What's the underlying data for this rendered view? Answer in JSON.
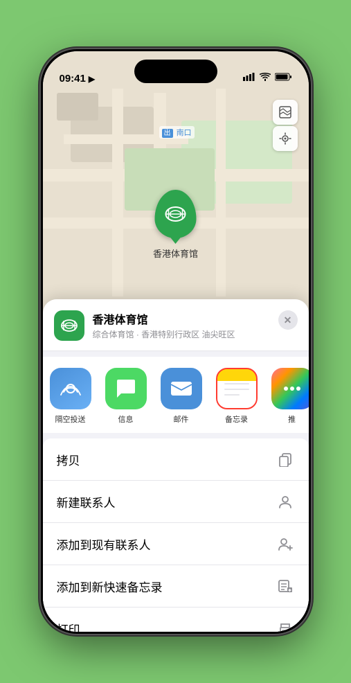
{
  "status_bar": {
    "time": "09:41",
    "location_arrow": "▶"
  },
  "map": {
    "label": "南口",
    "label_prefix": "出"
  },
  "venue": {
    "name": "香港体育馆",
    "subtitle": "综合体育馆 · 香港特别行政区 油尖旺区"
  },
  "share_items": [
    {
      "id": "airdrop",
      "label": "隔空投送",
      "class": "share-item-airdrop"
    },
    {
      "id": "message",
      "label": "信息",
      "class": "share-item-message"
    },
    {
      "id": "mail",
      "label": "邮件",
      "class": "share-item-mail"
    },
    {
      "id": "notes",
      "label": "备忘录",
      "class": "share-item-notes"
    },
    {
      "id": "more",
      "label": "推",
      "class": "share-item-more"
    }
  ],
  "actions": [
    {
      "id": "copy",
      "label": "拷贝",
      "icon": "copy"
    },
    {
      "id": "new-contact",
      "label": "新建联系人",
      "icon": "person"
    },
    {
      "id": "add-contact",
      "label": "添加到现有联系人",
      "icon": "person-add"
    },
    {
      "id": "add-note",
      "label": "添加到新快速备忘录",
      "icon": "note"
    },
    {
      "id": "print",
      "label": "打印",
      "icon": "print"
    }
  ]
}
